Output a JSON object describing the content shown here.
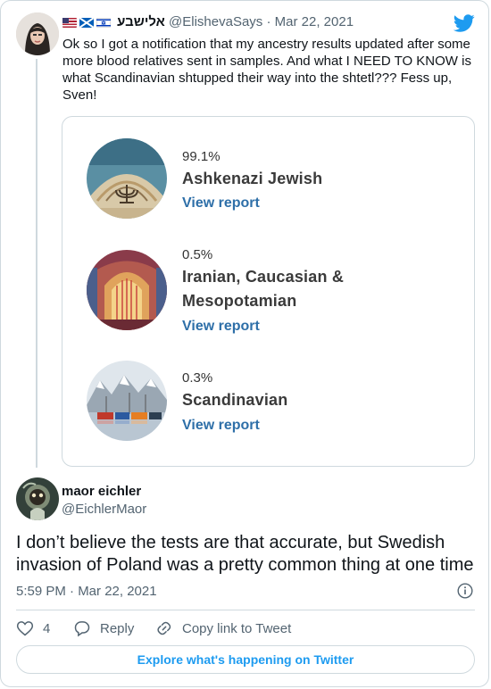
{
  "tweet": {
    "display_name": "אלישבע",
    "flags": [
      "us-flag",
      "scotland-flag",
      "israel-flag"
    ],
    "handle": "@ElishevaSays",
    "separator": "·",
    "date": "Mar 22, 2021",
    "text": "Ok so I got a notification that my ancestry results updated after some more blood relatives sent in samples. And what I NEED TO KNOW is what Scandinavian shtupped their way into the shtetl??? Fess up, Sven!",
    "card": {
      "items": [
        {
          "percent": "99.1%",
          "name": "Ashkenazi Jewish",
          "link": "View report"
        },
        {
          "percent": "0.5%",
          "name_line1": "Iranian, Caucasian &",
          "name_line2": "Mesopotamian",
          "link": "View report"
        },
        {
          "percent": "0.3%",
          "name": "Scandinavian",
          "link": "View report"
        }
      ]
    }
  },
  "reply": {
    "display_name": "maor eichler",
    "handle": "@EichlerMaor",
    "text": "I don’t believe the tests are that accurate, but Swedish invasion of Poland was a pretty common thing at one time",
    "time": "5:59 PM · Mar 22, 2021",
    "likes": "4",
    "reply_label": "Reply",
    "copy_label": "Copy link to Tweet",
    "explore_label": "Explore what's happening on Twitter"
  },
  "colors": {
    "twitter_blue": "#1d9bf0",
    "link_blue": "#2e6fa8",
    "muted": "#536471"
  }
}
